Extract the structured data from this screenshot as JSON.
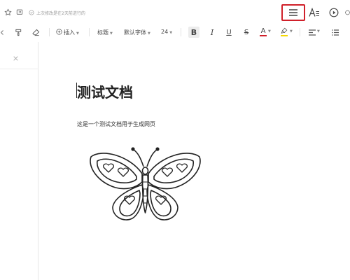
{
  "topbar": {
    "save_status": "上次修改是在2天前进行的",
    "icons": [
      "star-icon",
      "export-icon",
      "check-circle-icon",
      "menu-icon",
      "font-format-icon",
      "play-icon",
      "avatar-icon"
    ]
  },
  "toolbar": {
    "insert_label": "插入",
    "heading_label": "标题",
    "font_label": "默认字体",
    "font_size": "24",
    "bold_label": "B",
    "italic_label": "I",
    "underline_label": "U",
    "strike_label": "S",
    "font_color_label": "A"
  },
  "document": {
    "title": "测试文档",
    "paragraph": "这是一个测试文档用于生成网页"
  },
  "colors": {
    "highlight_box": "#d0202a",
    "font_color_bar": "#d0202a",
    "highlighter_bar": "#f5d800"
  }
}
